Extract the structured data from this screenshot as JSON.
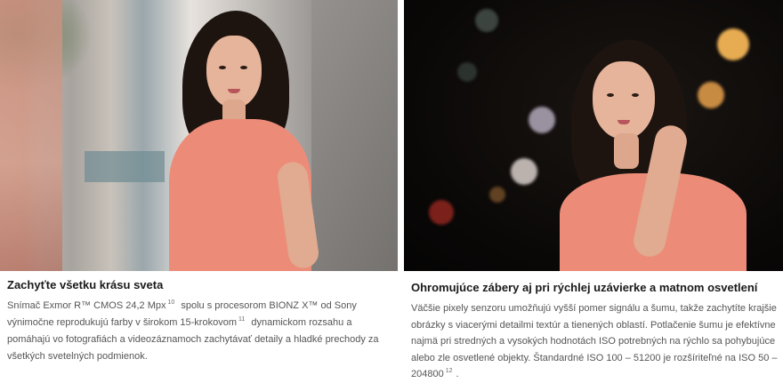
{
  "left_card": {
    "title": "Zachyťte všetku krásu sveta",
    "body_part1": "Snímač Exmor R™ CMOS 24,2 Mpx",
    "footnote1": "10",
    "body_part2": "spolu s procesorom BIONZ X™ od Sony výnimočne reprodukujú farby v širokom 15-krokovom",
    "footnote2": "11",
    "body_part3": "dynamickom rozsahu a pomáhajú vo fotografiách a videozáznamoch zachytávať detaily a hladké prechody za všetkých svetelných podmienok."
  },
  "right_card": {
    "title": "Ohromujúce zábery aj pri rýchlej uzávierke a matnom osvetlení",
    "body_part1": "Väčšie pixely senzoru umožňujú vyšší pomer signálu a šumu, takže zachytíte krajšie obrázky s viacerými detailmi textúr a tienených oblastí. Potlačenie šumu je efektívne najmä pri stredných a vysokých hodnotách ISO potrebných na rýchlo sa pohybujúce alebo zle osvetlené objekty. Štandardné ISO 100 – 51200 je rozšíriteľné na ISO 50 –",
    "body_part2": "204800",
    "footnote": "12",
    "body_part3": "."
  },
  "colors": {
    "dress": "#ec8c78",
    "title_text": "#1a1a1a",
    "body_text": "#555555"
  }
}
